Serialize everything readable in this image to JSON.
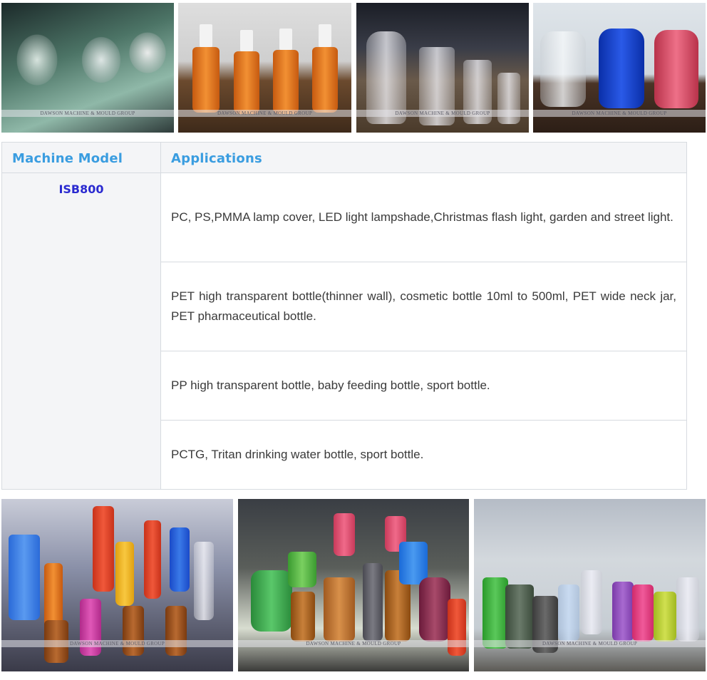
{
  "watermark": "DAWSON MACHINE & MOULD GROUP",
  "top_photos": [
    {
      "name": "lamp-covers-photo"
    },
    {
      "name": "orange-spray-bottles-photo"
    },
    {
      "name": "clear-bottles-photo"
    },
    {
      "name": "pitchers-photo"
    }
  ],
  "table": {
    "headers": {
      "model": "Machine Model",
      "applications": "Applications"
    },
    "model": "ISB800",
    "applications": [
      "PC, PS,PMMA lamp cover, LED light lampshade,Christmas flash light, garden and street light.",
      "PET high transparent bottle(thinner wall), cosmetic bottle 10ml to 500ml, PET wide neck jar, PET pharmaceutical bottle.",
      "PP high transparent bottle, baby feeding bottle, sport bottle.",
      "PCTG, Tritan drinking water bottle, sport bottle."
    ]
  },
  "bottom_photos": [
    {
      "name": "assorted-bottles-photo-1"
    },
    {
      "name": "assorted-bottles-photo-2"
    },
    {
      "name": "assorted-bottles-photo-3"
    }
  ],
  "colors": {
    "header_text": "#3a9de0",
    "model_text": "#2a2ad0",
    "body_text": "#3a3a3a"
  }
}
